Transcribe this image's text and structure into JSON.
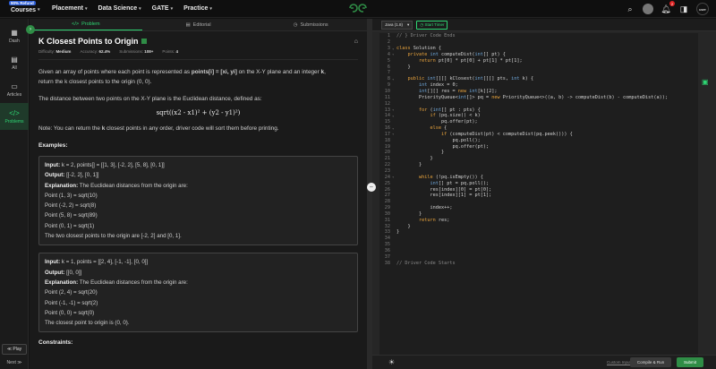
{
  "nav": {
    "refund_badge": "90% Refund",
    "courses": "Courses",
    "placement": "Placement",
    "data_science": "Data Science",
    "gate": "GATE",
    "practice": "Practice",
    "notifications_count": "2",
    "avatar_text": "user"
  },
  "sidebar": {
    "items": [
      {
        "label": "Dash",
        "icon": "dashboard-icon"
      },
      {
        "label": "All",
        "icon": "grid-icon"
      },
      {
        "label": "Articles",
        "icon": "article-icon"
      },
      {
        "label": "Problems",
        "icon": "code-icon"
      }
    ],
    "play_label": "≪ Play",
    "next_label": "Next ≫"
  },
  "tabs": {
    "problem": "Problem",
    "editorial": "Editorial",
    "submissions": "Submissions"
  },
  "problem": {
    "title": "K Closest Points to Origin",
    "difficulty_label": "Difficulty:",
    "difficulty": "Medium",
    "accuracy_label": "Accuracy:",
    "accuracy": "62.4%",
    "submissions_label": "Submissions:",
    "submissions": "108+",
    "points_label": "Points:",
    "points": "4",
    "p1a": "Given an array of points where each point is represented as ",
    "p1b": "points[i] = [xi, yi]",
    "p1c": " on the X-Y plane and an integer ",
    "p1d": "k",
    "p1e": ",",
    "p1f": "return the k closest points to the origin (0, 0).",
    "p2": "The distance between two points on the X-Y plane is the Euclidean distance, defined as:",
    "formula": "sqrt((x2 - x1)² + (y2 - y1)²)",
    "p3a": "Note: You can return the ",
    "p3b": "k",
    "p3c": " closest points in any order, driver code will sort them before printing.",
    "examples_heading": "Examples:",
    "constraints_heading": "Constraints:"
  },
  "examples": [
    {
      "input_label": "Input:",
      "input": " k = 2, points[] = [[1, 3], [-2, 2], [5, 8], [0, 1]]",
      "output_label": "Output:",
      "output": " [[-2, 2], [0, 1]]",
      "explanation_label": "Explanation:",
      "explanation": " The Euclidean distances from the origin are:",
      "lines": [
        "Point (1, 3) = sqrt(10)",
        "Point (-2, 2) = sqrt(8)",
        "Point (5, 8) = sqrt(89)",
        "Point (0, 1) = sqrt(1)",
        "The two closest points to the origin are [-2, 2] and [0, 1]."
      ]
    },
    {
      "input_label": "Input:",
      "input": " k = 1, points = [[2, 4], [-1, -1], [0, 0]]",
      "output_label": "Output:",
      "output": " [[0, 0]]",
      "explanation_label": "Explanation:",
      "explanation": " The Euclidean distances from the origin are:",
      "lines": [
        "Point (2, 4) = sqrt(20)",
        "Point (-1, -1) = sqrt(2)",
        "Point (0, 0) = sqrt(0)",
        "The closest point to origin is (0, 0)."
      ]
    }
  ],
  "editor": {
    "language": "Java (1.8)",
    "start_timer": "Start Timer",
    "custom_input": "Custom Input",
    "compile_run": "Compile & Run",
    "submit": "Submit"
  },
  "code_lines": [
    "// } Driver Code Ends",
    "",
    "class Solution {",
    "    private int computeDist(int[] pt) {",
    "        return pt[0] * pt[0] + pt[1] * pt[1];",
    "    }",
    "",
    "    public int[][] kClosest(int[][] pts, int k) {",
    "        int index = 0;",
    "        int[][] res = new int[k][2];",
    "        PriorityQueue<int[]> pq = new PriorityQueue<>((a, b) -> computeDist(b) - computeDist(a));",
    "",
    "        for (int[] pt : pts) {",
    "            if (pq.size() < k)",
    "                pq.offer(pt);",
    "            else {",
    "                if (computeDist(pt) < computeDist(pq.peek())) {",
    "                    pq.poll();",
    "                    pq.offer(pt);",
    "                }",
    "            }",
    "        }",
    "",
    "        while (!pq.isEmpty()) {",
    "            int[] pt = pq.poll();",
    "            res[index][0] = pt[0];",
    "            res[index][1] = pt[1];",
    "",
    "            index++;",
    "        }",
    "        return res;",
    "    }",
    "}",
    "",
    "",
    "",
    "",
    "// Driver Code Starts"
  ]
}
